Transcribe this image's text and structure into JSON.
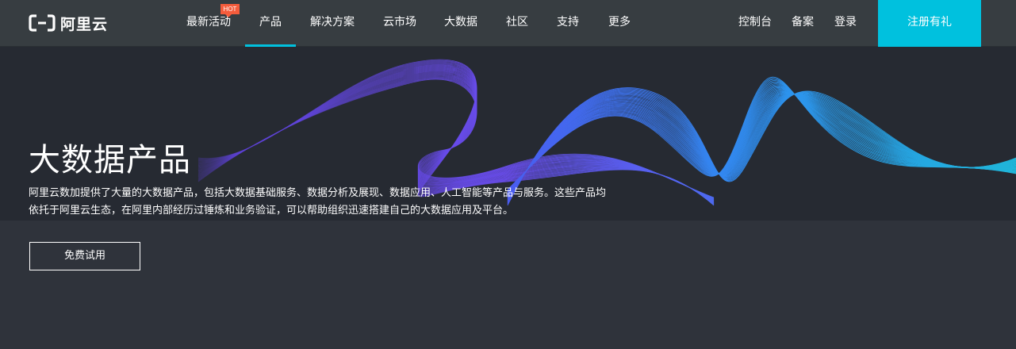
{
  "brand": {
    "name": "阿里云"
  },
  "nav": {
    "items": [
      {
        "label": "最新活动",
        "badge": "HOT"
      },
      {
        "label": "产品",
        "active": true
      },
      {
        "label": "解决方案"
      },
      {
        "label": "云市场"
      },
      {
        "label": "大数据"
      },
      {
        "label": "社区"
      },
      {
        "label": "支持"
      },
      {
        "label": "更多"
      }
    ],
    "right": [
      "控制台",
      "备案",
      "登录"
    ],
    "signup": "注册有礼"
  },
  "banner": {
    "title": "大数据产品",
    "description": "阿里云数加提供了大量的大数据产品，包括大数据基础服务、数据分析及展现、数据应用、人工智能等产品与服务。这些产品均依托于阿里云生态，在阿里内部经历过锤炼和业务验证，可以帮助组织迅速搭建自己的大数据应用及平台。"
  },
  "cta": {
    "label": "免费试用"
  },
  "colors": {
    "accent": "#00c1de",
    "hot": "#f45c3c",
    "nav_bg": "#373d41",
    "banner_bg": "#262a32",
    "page_bg": "#2f333b"
  }
}
